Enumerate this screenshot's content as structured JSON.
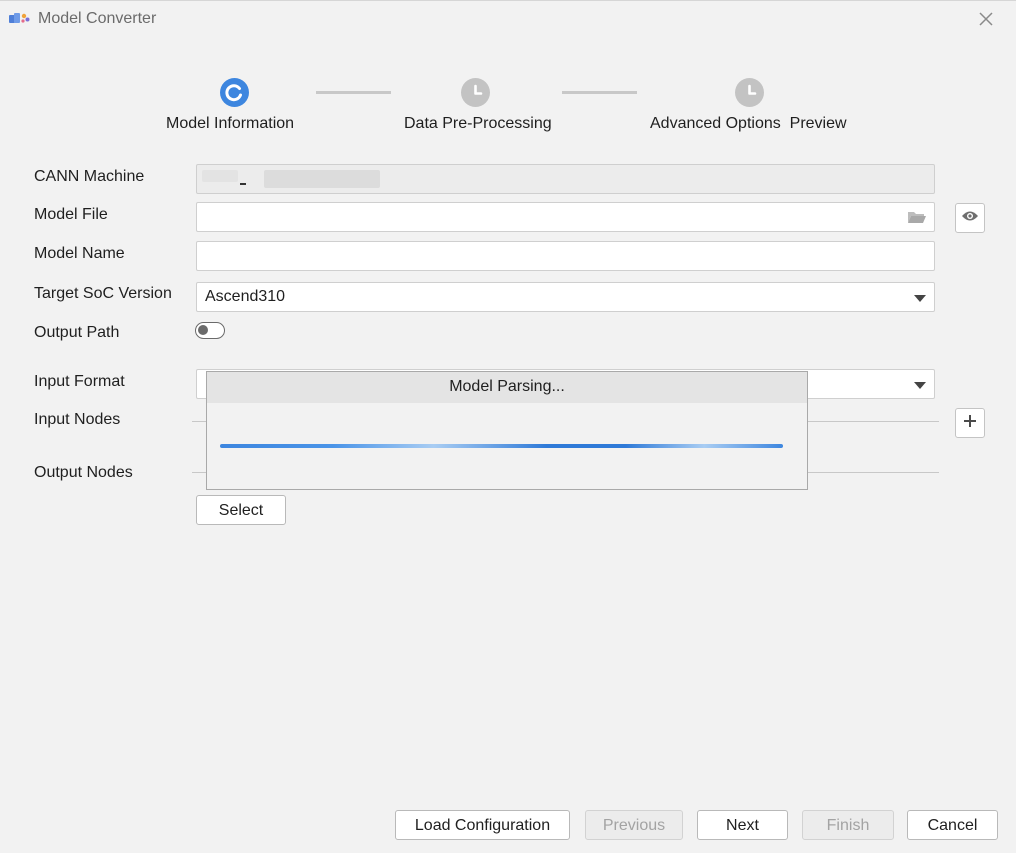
{
  "window": {
    "title": "Model Converter"
  },
  "stepper": {
    "steps": [
      {
        "label": "Model Information",
        "state": "active",
        "icon": "refresh-icon"
      },
      {
        "label": "Data Pre-Processing",
        "state": "pending",
        "icon": "clock-icon"
      },
      {
        "label": "Advanced Options  Preview",
        "state": "pending",
        "icon": "clock-icon"
      }
    ]
  },
  "form": {
    "cann_machine": {
      "label": "CANN Machine",
      "value": ""
    },
    "model_file": {
      "label": "Model File",
      "value": "",
      "icon": "folder-icon",
      "side_icon": "eye-icon"
    },
    "model_name": {
      "label": "Model Name",
      "value": ""
    },
    "target_soc": {
      "label": "Target SoC Version",
      "value": "Ascend310"
    },
    "output_path": {
      "label": "Output Path",
      "toggle": false
    },
    "input_format": {
      "label": "Input Format",
      "value": ""
    },
    "input_nodes": {
      "label": "Input Nodes",
      "add_icon": "plus-icon"
    },
    "output_nodes": {
      "label": "Output Nodes"
    },
    "select_button": "Select"
  },
  "modal": {
    "title": "Model Parsing..."
  },
  "footer": {
    "load_configuration": "Load Configuration",
    "previous": "Previous",
    "next": "Next",
    "finish": "Finish",
    "cancel": "Cancel"
  },
  "colors": {
    "accent": "#3d86df",
    "step_pending": "#c3c3c3",
    "background": "#f2f2f2"
  }
}
